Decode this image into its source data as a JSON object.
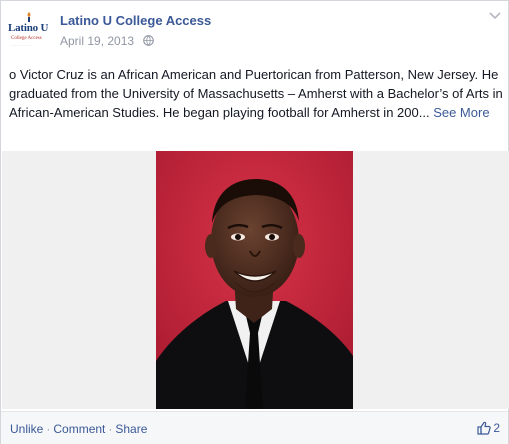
{
  "post": {
    "page_name": "Latino U College Access",
    "timestamp": "April 19, 2013",
    "privacy_icon": "globe-icon",
    "menu_icon": "chevron-down-icon",
    "logo": {
      "brand": "Latino U",
      "subtitle": "College Access",
      "tagline": "·········· ·········"
    },
    "text": "o Victor Cruz is an African American and Puertorican from Patterson, New Jersey. He graduated from the University of Massachusetts – Amherst with a Bachelor’s of Arts in African-American Studies. He began playing football for Amherst in 200...",
    "see_more": "See More",
    "photo": {
      "background_color": "#c8253d",
      "description_icon": "portrait-photo"
    }
  },
  "footer": {
    "unlike": "Unlike",
    "separator": "·",
    "comment": "Comment",
    "share": "Share",
    "like_icon": "thumbs-up-icon",
    "like_count": "2"
  },
  "colors": {
    "link": "#3b5998",
    "meta": "#9197a3",
    "text": "#141823"
  }
}
